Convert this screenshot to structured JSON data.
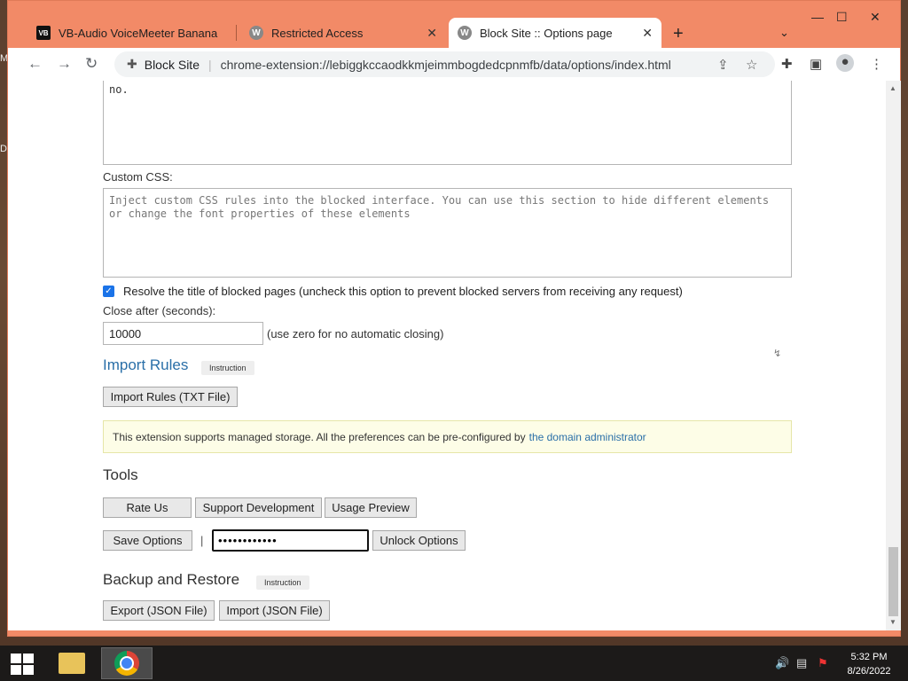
{
  "desktop": {
    "edge_labels": [
      "M",
      "D"
    ]
  },
  "browser": {
    "tabs": [
      {
        "title": "VB-Audio VoiceMeeter Banana",
        "icon": "vb-icon"
      },
      {
        "title": "Restricted Access",
        "icon": "w-icon"
      },
      {
        "title": "Block Site :: Options page",
        "icon": "w-icon",
        "active": true
      }
    ],
    "omnibox": {
      "site_label": "Block Site",
      "url": "chrome-extension://lebiggkccaodkkmjeimmbogdedcpnmfb/data/options/index.html"
    }
  },
  "page": {
    "top_textarea_value": "no.",
    "custom_css_label": "Custom CSS:",
    "custom_css_placeholder": "Inject custom CSS rules into the blocked interface. You can use this section to hide different elements or change the font properties of these elements",
    "resolve_title_label": "Resolve the title of blocked pages (uncheck this option to prevent blocked servers from receiving any request)",
    "resolve_title_checked": true,
    "close_after_label": "Close after (seconds):",
    "close_after_value": "10000",
    "close_after_hint": "(use zero for no automatic closing)",
    "import_rules_heading": "Import Rules",
    "instruction_tag": "Instruction",
    "import_rules_button": "Import Rules (TXT File)",
    "managed_notice_text": "This extension supports managed storage. All the preferences can be pre-configured by",
    "managed_notice_link": "the domain administrator",
    "tools_heading": "Tools",
    "rate_us_button": "Rate Us",
    "support_dev_button": "Support Development",
    "usage_preview_button": "Usage Preview",
    "save_options_button": "Save Options",
    "pipe": "|",
    "password_value": "••••••••••••",
    "unlock_options_button": "Unlock Options",
    "backup_heading": "Backup and Restore",
    "export_button": "Export (JSON File)",
    "import_button": "Import (JSON File)"
  },
  "taskbar": {
    "time": "5:32 PM",
    "date": "8/26/2022"
  }
}
